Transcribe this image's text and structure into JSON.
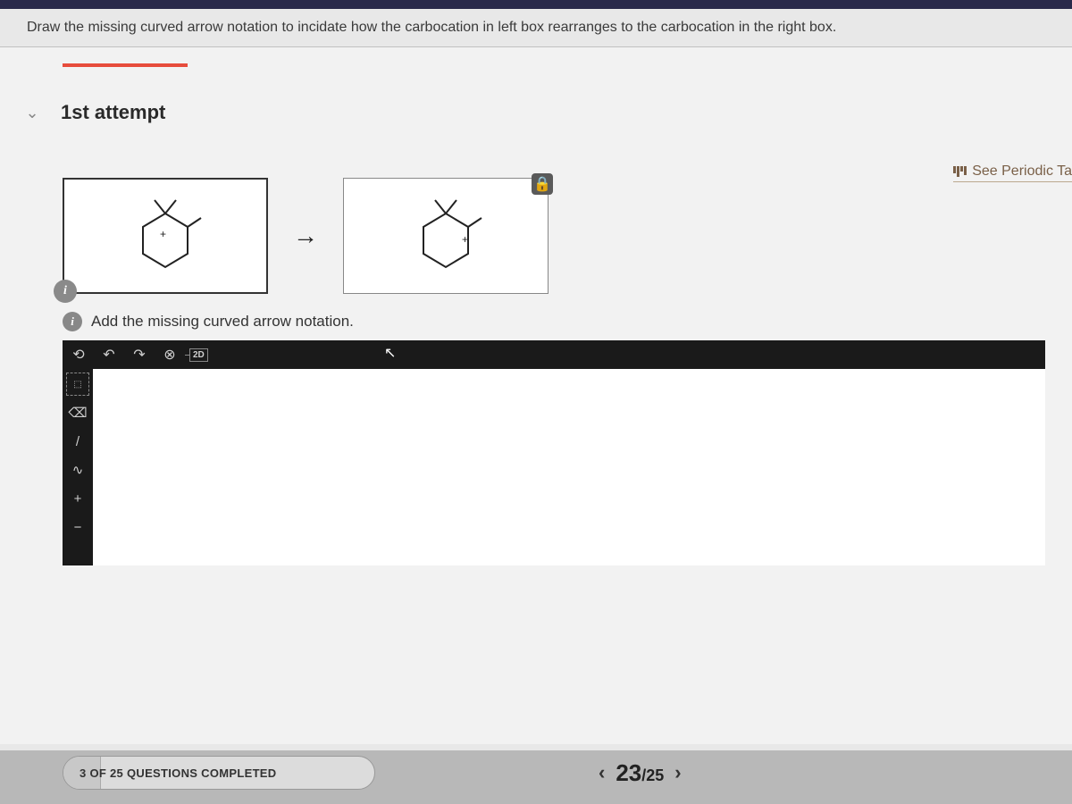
{
  "question": "Draw the missing curved arrow notation to incidate how the carbocation in left box rearranges to the carbocation in the right box.",
  "attempt": {
    "label": "1st attempt"
  },
  "links": {
    "periodic": "See Periodic Ta"
  },
  "hint": {
    "text": "Add the missing curved arrow notation."
  },
  "toolbar": {
    "reset": "⟲",
    "undo": "↶",
    "redo": "↷",
    "close": "⊗",
    "mode2d": "2D"
  },
  "sidebar": {
    "marquee": "⬚",
    "eraser": "⌫",
    "bond": "/",
    "chain": "∿",
    "plus": "+",
    "minus": "−"
  },
  "progress": {
    "text": "3 OF 25 QUESTIONS COMPLETED"
  },
  "pagination": {
    "current": "23",
    "sep": "/",
    "total": "25"
  },
  "icons": {
    "info": "i",
    "lock": "🔒",
    "arrow_right": "→",
    "chevron_down": "⌄",
    "chevron_left": "‹",
    "chevron_right": "›",
    "cursor": "↖"
  }
}
